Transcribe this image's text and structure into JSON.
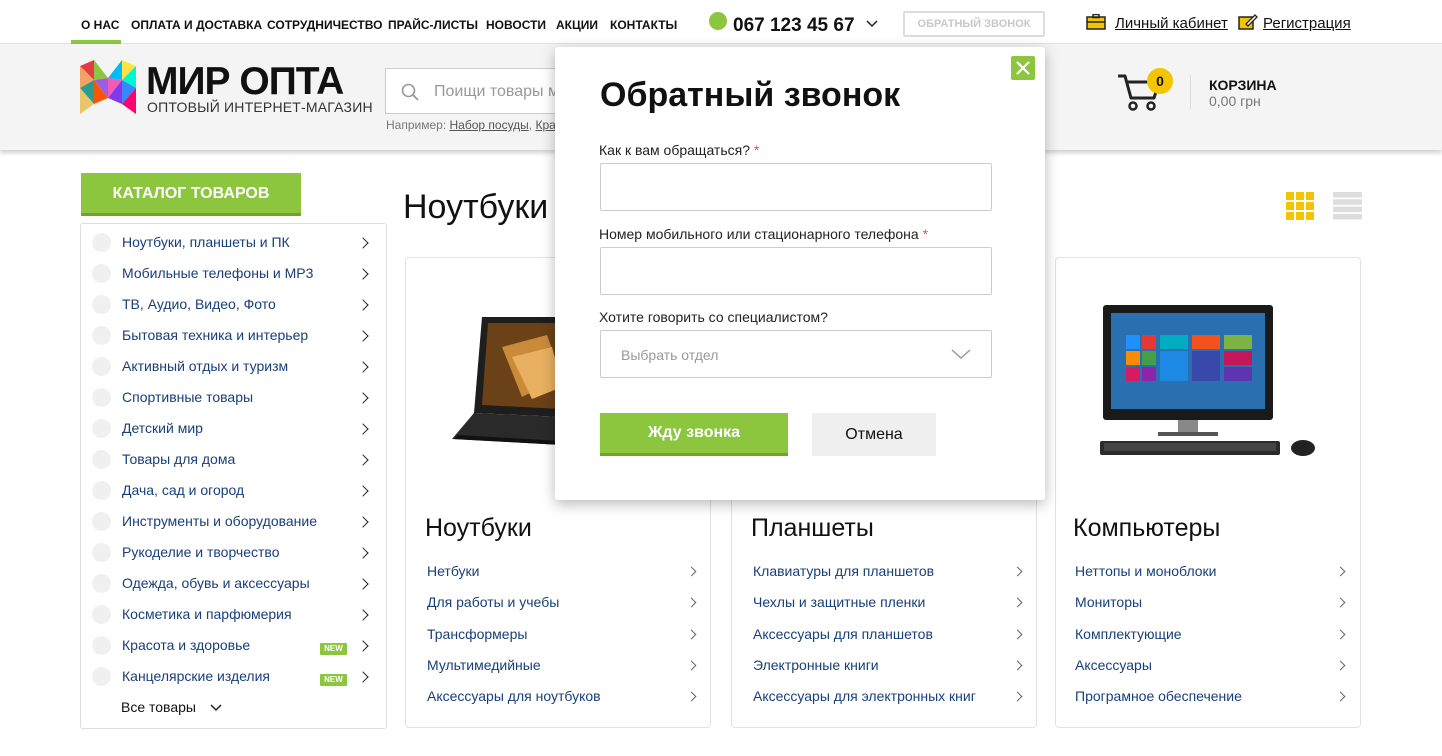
{
  "topbar": {
    "nav": [
      "О нас",
      "Оплата и доставка",
      "Сотрудничество",
      "Прайс-листы",
      "Новости",
      "Акции",
      "Контакты"
    ],
    "phone": "067 123 45 67",
    "callback_button": "Обратный звонок",
    "account_link": "Личный кабинет",
    "register_link": "Регистрация"
  },
  "header": {
    "logo_title": "МИР ОПТА",
    "logo_subtitle": "ОПТОВЫЙ ИНТЕРНЕТ-МАГАЗИН",
    "search_placeholder": "Поищи товары м",
    "search_hint_prefix": "Например:",
    "search_hint_1": "Набор посуды",
    "search_hint_2": "Кра",
    "cart_count": "0",
    "cart_title": "КОРЗИНА",
    "cart_sum": "0,00 грн"
  },
  "catalog": {
    "button": "Каталог товаров",
    "items": [
      {
        "label": "Ноутбуки, планшеты и ПК",
        "new": ""
      },
      {
        "label": "Мобильные телефоны и MP3",
        "new": ""
      },
      {
        "label": "ТВ, Аудио, Видео, Фото",
        "new": ""
      },
      {
        "label": "Бытовая техника и интерьер",
        "new": ""
      },
      {
        "label": "Активный отдых и туризм",
        "new": ""
      },
      {
        "label": "Спортивные товары",
        "new": ""
      },
      {
        "label": "Детский мир",
        "new": ""
      },
      {
        "label": "Товары для дома",
        "new": ""
      },
      {
        "label": "Дача, сад и огород",
        "new": ""
      },
      {
        "label": "Инструменты и оборудование",
        "new": ""
      },
      {
        "label": "Рукоделие и творчество",
        "new": ""
      },
      {
        "label": "Одежда, обувь и аксессуары",
        "new": ""
      },
      {
        "label": "Косметика и парфюмерия",
        "new": ""
      },
      {
        "label": "Красота и здоровье",
        "new": "NEW"
      },
      {
        "label": "Канцелярские изделия",
        "new": "NEW"
      }
    ],
    "all_goods": "Все товары"
  },
  "main": {
    "title": "Ноутбуки",
    "cards": [
      {
        "title": "Ноутбуки",
        "links": [
          "Нетбуки",
          "Для работы и учебы",
          "Трансформеры",
          "Мультимедийные",
          "Аксессуары для ноутбуков"
        ]
      },
      {
        "title": "Планшеты",
        "links": [
          "Клавиатуры для планшетов",
          "Чехлы и защитные пленки",
          "Аксессуары для планшетов",
          "Электронные книги",
          "Аксессуары для электронных книг"
        ]
      },
      {
        "title": "Компьютеры",
        "links": [
          "Неттопы и моноблоки",
          "Мониторы",
          "Комплектующие",
          "Аксессуары",
          "Програмное обеспечение"
        ]
      }
    ],
    "view_colors": {
      "grid": "#f5c400",
      "list": "#dddddd"
    }
  },
  "modal": {
    "title": "Обратный звонок",
    "name_label": "Как к вам обращаться?",
    "phone_label": "Номер мобильного или стационарного телефона",
    "required_mark": "*",
    "dept_label": "Хотите говорить со специалистом?",
    "dept_placeholder": "Выбрать отдел",
    "submit": "Жду звонка",
    "cancel": "Отмена"
  },
  "colors": {
    "accent": "#8cc63f",
    "badge": "#f5c400",
    "link": "#183f7a"
  }
}
